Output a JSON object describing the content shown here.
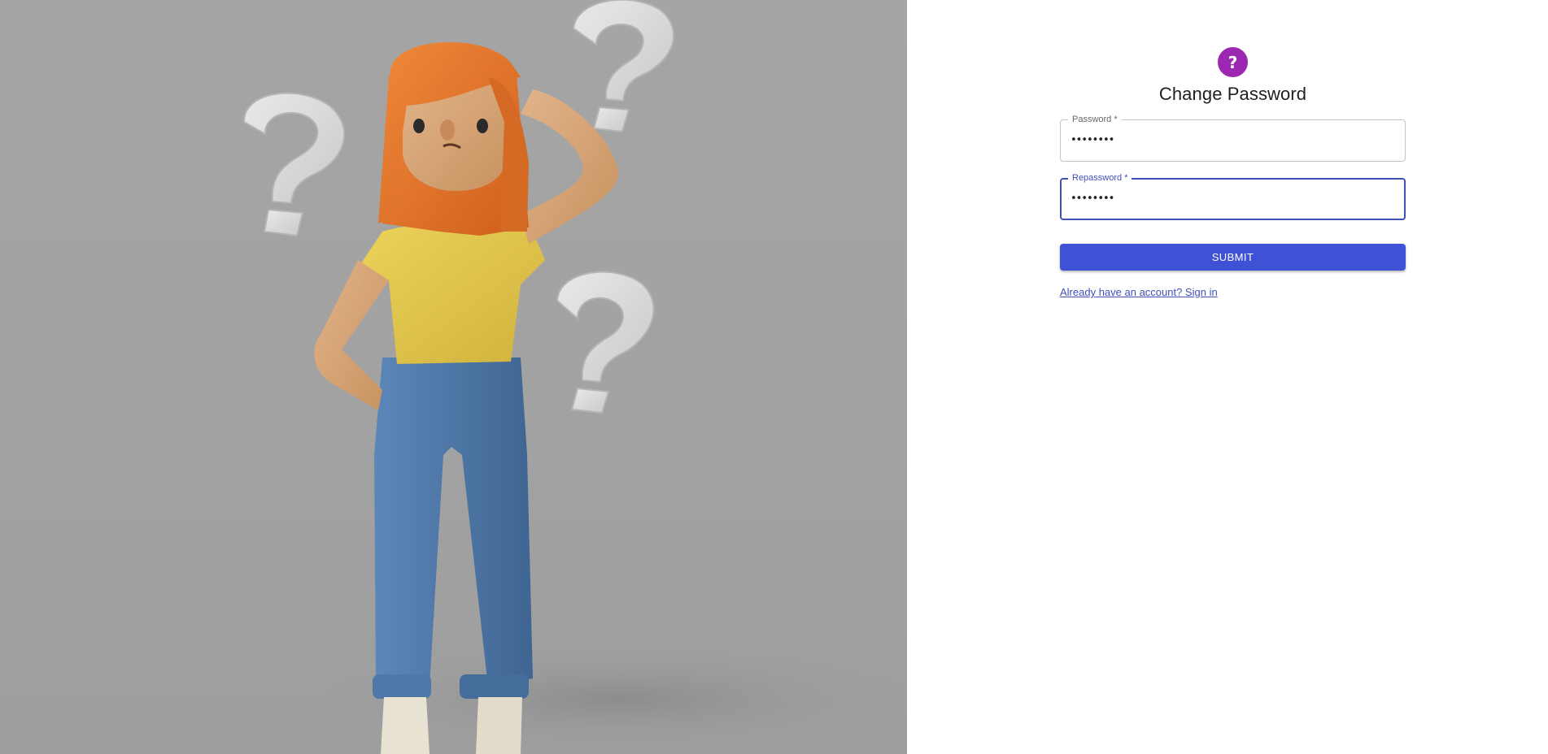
{
  "illustration": {
    "icon": "confused-woman-illustration",
    "background": "#a3a3a3"
  },
  "form": {
    "avatar_icon": "?",
    "avatar_color": "#9c27b0",
    "title": "Change Password",
    "password": {
      "label": "Password *",
      "value": "••••••••"
    },
    "repassword": {
      "label": "Repassword *",
      "value": "••••••••"
    },
    "submit_label": "SUBMIT",
    "signin_link": "Already have an account? Sign in",
    "accent_color": "#3f51b5"
  }
}
